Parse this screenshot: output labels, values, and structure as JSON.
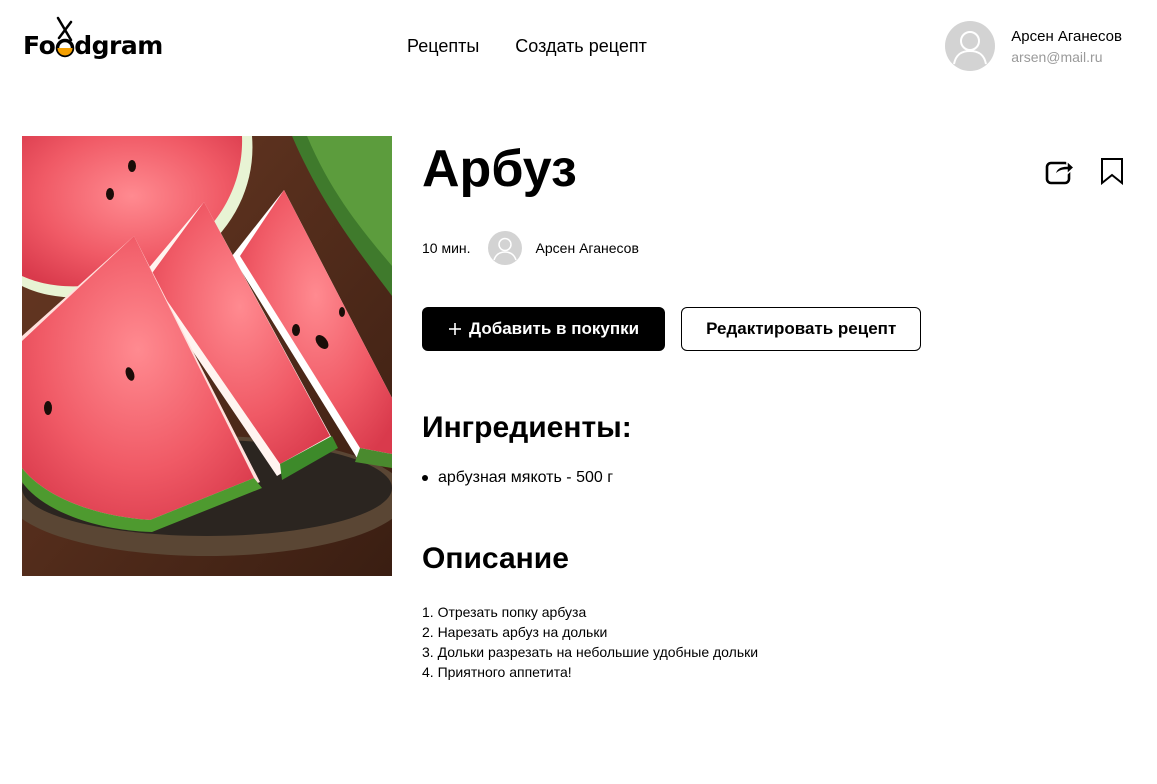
{
  "header": {
    "logo": "Foodgram",
    "nav": [
      {
        "label": "Рецепты"
      },
      {
        "label": "Создать рецепт"
      }
    ],
    "user": {
      "name": "Арсен Аганесов",
      "email": "arsen@mail.ru"
    }
  },
  "recipe": {
    "title": "Арбуз",
    "cook_time": "10 мин.",
    "author": "Арсен Аганесов",
    "add_to_cart_label": "Добавить в покупки",
    "edit_label": "Редактировать рецепт",
    "ingredients_title": "Ингредиенты:",
    "ingredients": [
      "арбузная мякоть - 500 г"
    ],
    "description_title": "Описание",
    "description": [
      "1. Отрезать попку арбуза",
      "2. Нарезать арбуз на дольки",
      "3. Дольки разрезать на небольшие удобные дольки",
      "4. Приятного аппетита!"
    ]
  },
  "icons": {
    "share": "share-icon",
    "bookmark": "bookmark-icon",
    "avatar": "user-avatar-icon"
  }
}
